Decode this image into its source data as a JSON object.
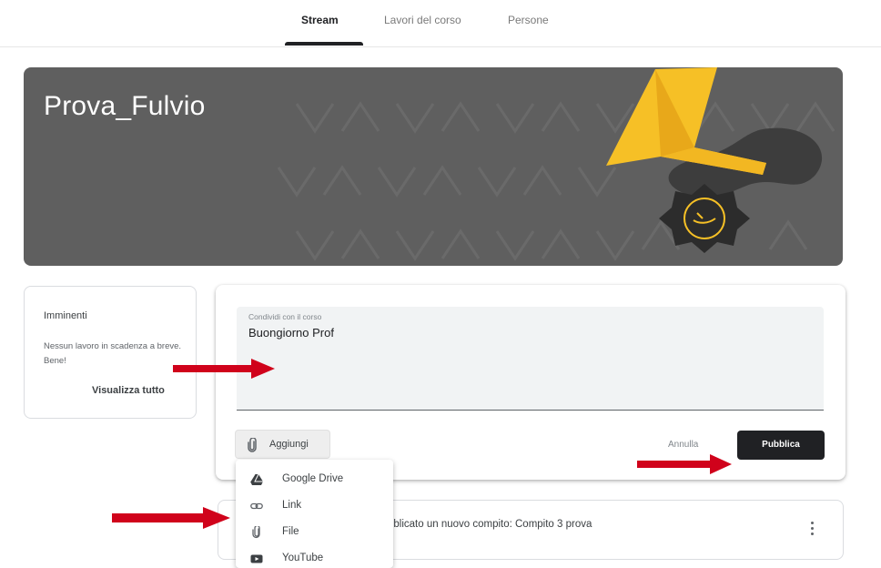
{
  "tabs": [
    {
      "label": "Stream",
      "active": true
    },
    {
      "label": "Lavori del corso",
      "active": false
    },
    {
      "label": "Persone",
      "active": false
    }
  ],
  "banner": {
    "title": "Prova_Fulvio",
    "background": "#5f5f5f"
  },
  "upcoming": {
    "title": "Imminenti",
    "text": "Nessun lavoro in scadenza a breve. Bene!",
    "view_all": "Visualizza tutto"
  },
  "composer": {
    "label": "Condividi con il corso",
    "value": "Buongiorno Prof",
    "add_label": "Aggiungi",
    "cancel_label": "Annulla",
    "publish_label": "Pubblica"
  },
  "add_menu": {
    "items": [
      {
        "label": "Google Drive",
        "icon": "google-drive-icon"
      },
      {
        "label": "Link",
        "icon": "link-icon"
      },
      {
        "label": "File",
        "icon": "paperclip-icon"
      },
      {
        "label": "YouTube",
        "icon": "youtube-icon"
      }
    ]
  },
  "post": {
    "text": "bblicato un nuovo compito: Compito 3 prova"
  },
  "colors": {
    "accent_dark": "#202124",
    "annotation_arrow": "#d0021b",
    "banner_yellow": "#f6c026"
  }
}
